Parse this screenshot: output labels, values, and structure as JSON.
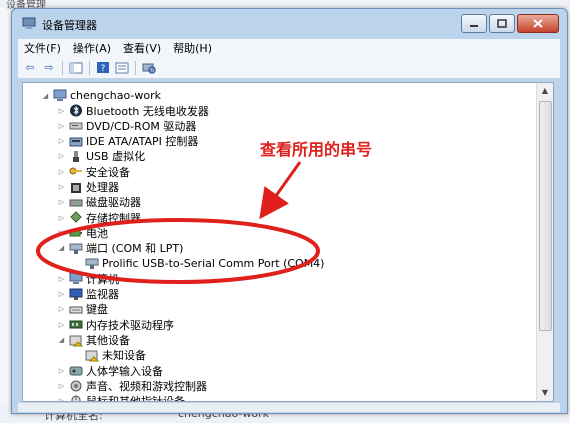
{
  "background": {
    "top_text": "设备管理",
    "bottom_label": "计算机全名:",
    "bottom_value": "chengchao-work"
  },
  "window": {
    "title": "设备管理器"
  },
  "menu": [
    "文件(F)",
    "操作(A)",
    "查看(V)",
    "帮助(H)"
  ],
  "tree": {
    "root": "chengchao-work",
    "items": [
      {
        "label": "Bluetooth 无线电收发器",
        "icon": "bluetooth-icon",
        "level": 1,
        "expander": "collapsed"
      },
      {
        "label": "DVD/CD-ROM 驱动器",
        "icon": "dvd-drive-icon",
        "level": 1,
        "expander": "collapsed"
      },
      {
        "label": "IDE ATA/ATAPI 控制器",
        "icon": "ide-controller-icon",
        "level": 1,
        "expander": "collapsed"
      },
      {
        "label": "USB 虚拟化",
        "icon": "usb-icon",
        "level": 1,
        "expander": "collapsed"
      },
      {
        "label": "安全设备",
        "icon": "key-icon",
        "level": 1,
        "expander": "collapsed"
      },
      {
        "label": "处理器",
        "icon": "processor-icon",
        "level": 1,
        "expander": "collapsed"
      },
      {
        "label": "磁盘驱动器",
        "icon": "disk-icon",
        "level": 1,
        "expander": "collapsed"
      },
      {
        "label": "存储控制器",
        "icon": "storage-icon",
        "level": 1,
        "expander": "collapsed"
      },
      {
        "label": "电池",
        "icon": "battery-icon",
        "level": 1,
        "expander": "collapsed"
      },
      {
        "label": "端口 (COM 和 LPT)",
        "icon": "port-icon",
        "level": 1,
        "expander": "expanded"
      },
      {
        "label": "Prolific USB-to-Serial Comm Port (COM4)",
        "icon": "port-icon",
        "level": 2,
        "expander": "none"
      },
      {
        "label": "计算机",
        "icon": "computer-icon",
        "level": 1,
        "expander": "collapsed"
      },
      {
        "label": "监视器",
        "icon": "monitor-icon",
        "level": 1,
        "expander": "collapsed"
      },
      {
        "label": "键盘",
        "icon": "keyboard-icon",
        "level": 1,
        "expander": "collapsed"
      },
      {
        "label": "内存技术驱动程序",
        "icon": "memory-icon",
        "level": 1,
        "expander": "collapsed"
      },
      {
        "label": "其他设备",
        "icon": "unknown-device-icon",
        "level": 1,
        "expander": "expanded"
      },
      {
        "label": "未知设备",
        "icon": "unknown-device-icon",
        "level": 2,
        "expander": "none"
      },
      {
        "label": "人体学输入设备",
        "icon": "hid-icon",
        "level": 1,
        "expander": "collapsed"
      },
      {
        "label": "声音、视频和游戏控制器",
        "icon": "sound-icon",
        "level": 1,
        "expander": "collapsed"
      },
      {
        "label": "鼠标和其他指针设备",
        "icon": "mouse-icon",
        "level": 1,
        "expander": "collapsed"
      }
    ]
  },
  "annotation": {
    "text": "查看所用的串号",
    "color": "#e0201c"
  }
}
